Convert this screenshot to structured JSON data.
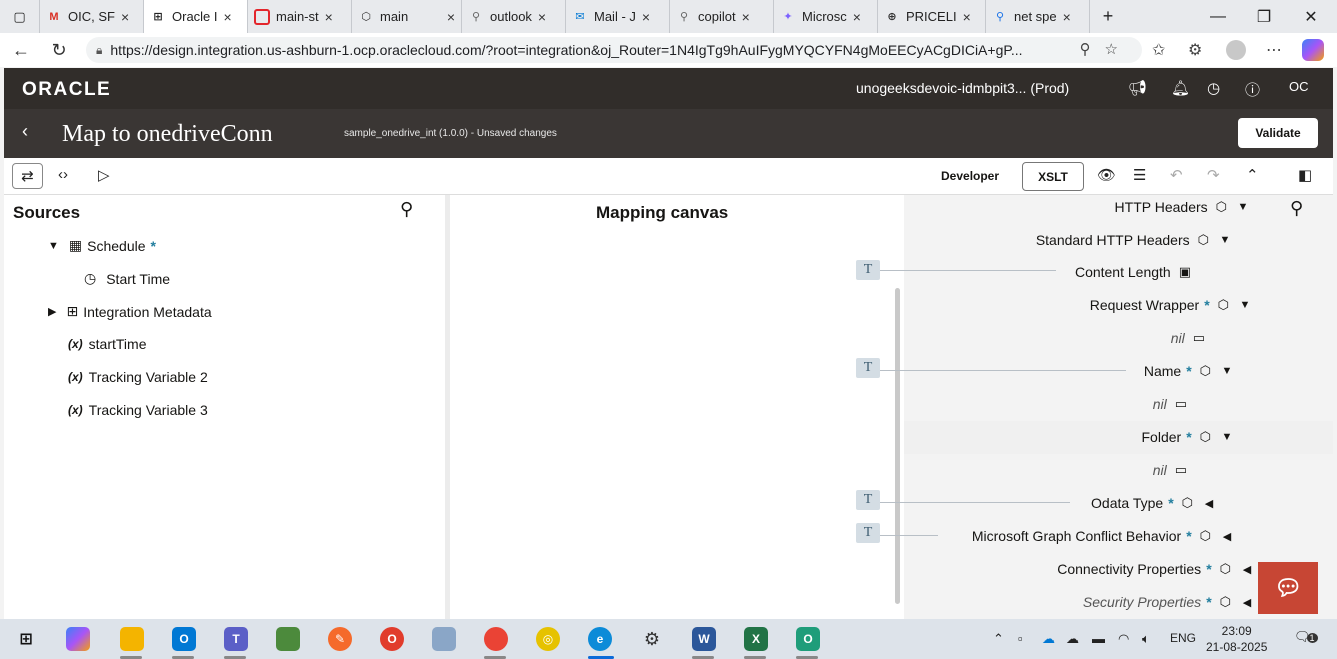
{
  "browser": {
    "tabs": [
      {
        "label": "OIC, SF",
        "icon": "M",
        "color": "#d93025"
      },
      {
        "label": "Oracle I",
        "icon": "⊞",
        "color": "#222222",
        "active": true
      },
      {
        "label": "main-st",
        "icon": "▭",
        "color": "#e3262c"
      },
      {
        "label": "main",
        "icon": "⬡",
        "color": "#333333"
      },
      {
        "label": "outlook",
        "icon": "⚲",
        "color": "#666666"
      },
      {
        "label": "Mail - J",
        "icon": "✉",
        "color": "#0078d4"
      },
      {
        "label": "copilot",
        "icon": "⚲",
        "color": "#666666"
      },
      {
        "label": "Microsc",
        "icon": "✦",
        "color": "#7b61ff"
      },
      {
        "label": "PRICELI",
        "icon": "⊕",
        "color": "#333333"
      },
      {
        "label": "net spe",
        "icon": "⚲",
        "color": "#1a73e8"
      }
    ],
    "url": "https://design.integration.us-ashburn-1.ocp.oraclecloud.com/?root=integration&oj_Router=1N4IgTg9hAuIFygMYQCYFN4gMoEECyACgDICiA+gP..."
  },
  "oracle_header": {
    "logo": "ORACLE",
    "instance": "unogeeksdevoic-idmbpit3...  (Prod)",
    "user": "OC"
  },
  "map_bar": {
    "title": "Map to onedriveConn",
    "subtitle": "sample_onedrive_int (1.0.0) - Unsaved changes",
    "validate_label": "Validate"
  },
  "toolbar": {
    "developer_label": "Developer",
    "xslt_label": "XSLT"
  },
  "sources": {
    "title": "Sources",
    "items": [
      {
        "label": "Schedule",
        "required": "*"
      },
      {
        "label": "Start Time"
      },
      {
        "label": "Integration Metadata"
      },
      {
        "label": "startTime",
        "prefix": "(x)"
      },
      {
        "label": "Tracking Variable 2",
        "prefix": "(x)"
      },
      {
        "label": "Tracking Variable 3",
        "prefix": "(x)"
      }
    ]
  },
  "canvas": {
    "title": "Mapping canvas",
    "t_label": "T"
  },
  "target": {
    "items": [
      {
        "label": "HTTP Headers"
      },
      {
        "label": "Standard HTTP Headers"
      },
      {
        "label": "Content Length"
      },
      {
        "label": "Request Wrapper",
        "required": "*"
      },
      {
        "label": "nil"
      },
      {
        "label": "Name",
        "required": "*"
      },
      {
        "label": "nil"
      },
      {
        "label": "Folder",
        "required": "*"
      },
      {
        "label": "nil"
      },
      {
        "label": "Odata Type",
        "required": "*"
      },
      {
        "label": "Microsoft Graph Conflict Behavior",
        "required": "*"
      },
      {
        "label": "Connectivity Properties",
        "required": "*"
      },
      {
        "label": "Security Properties",
        "required": "*"
      }
    ]
  },
  "taskbar": {
    "lang": "ENG",
    "time": "23:09",
    "date": "21-08-2025",
    "notif_count": "1"
  }
}
